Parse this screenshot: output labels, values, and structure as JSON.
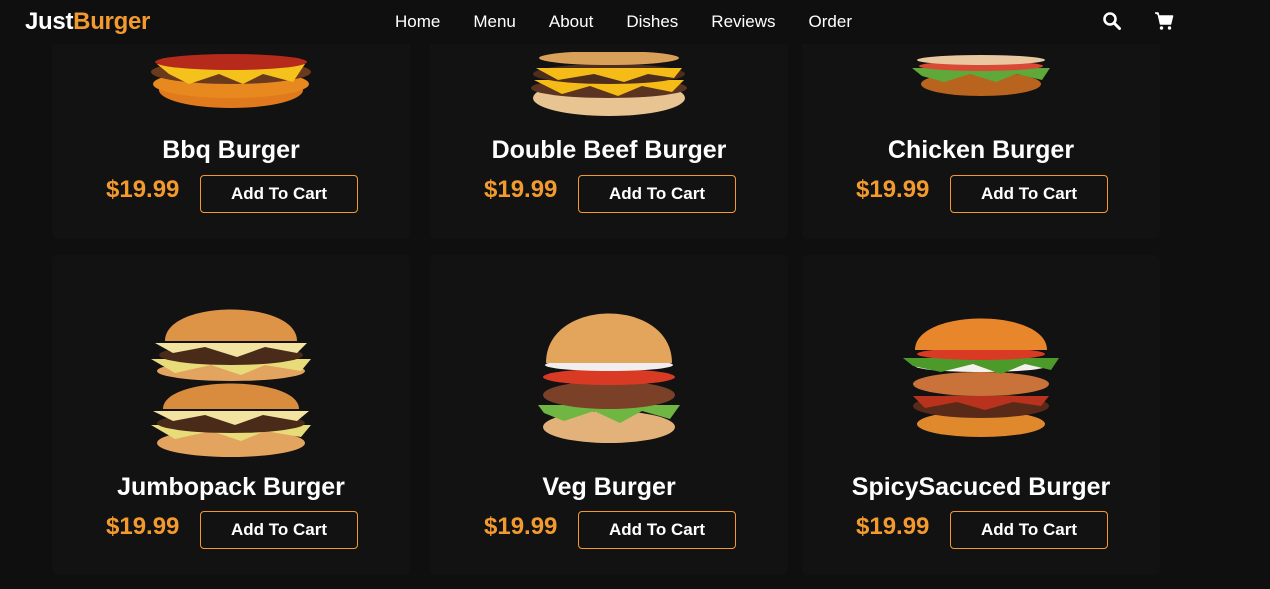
{
  "brand": {
    "part1": "Just",
    "part2": "Burger",
    "accent_color": "#f29a2e"
  },
  "nav": {
    "links": [
      "Home",
      "Menu",
      "About",
      "Dishes",
      "Reviews",
      "Order"
    ]
  },
  "icons": {
    "search": "search-icon",
    "cart": "cart-icon"
  },
  "products": [
    {
      "name": "Bbq Burger",
      "price": "$19.99",
      "button": "Add To Cart"
    },
    {
      "name": "Double Beef Burger",
      "price": "$19.99",
      "button": "Add To Cart"
    },
    {
      "name": "Chicken Burger",
      "price": "$19.99",
      "button": "Add To Cart"
    },
    {
      "name": "Jumbopack Burger",
      "price": "$19.99",
      "button": "Add To Cart"
    },
    {
      "name": "Veg Burger",
      "price": "$19.99",
      "button": "Add To Cart"
    },
    {
      "name": "SpicySacuced Burger",
      "price": "$19.99",
      "button": "Add To Cart"
    }
  ]
}
